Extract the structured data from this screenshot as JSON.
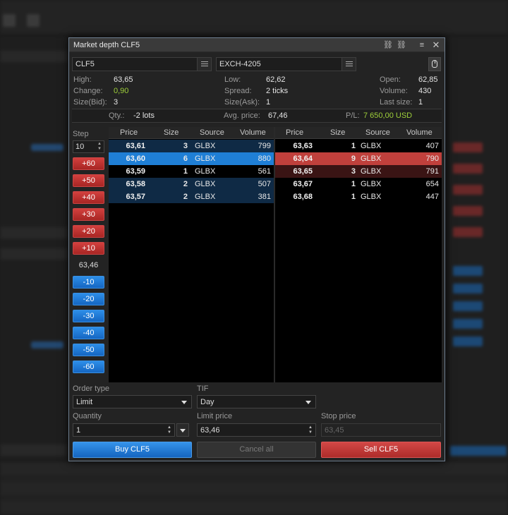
{
  "window": {
    "title": "Market depth CLF5"
  },
  "symbol": {
    "value": "CLF5"
  },
  "exchange": {
    "value": "EXCH-4205"
  },
  "stats": {
    "high_label": "High:",
    "high": "63,65",
    "change_label": "Change:",
    "change": "0,90",
    "size_bid_label": "Size(Bid):",
    "size_bid": "3",
    "low_label": "Low:",
    "low": "62,62",
    "spread_label": "Spread:",
    "spread": "2 ticks",
    "size_ask_label": "Size(Ask):",
    "size_ask": "1",
    "open_label": "Open:",
    "open": "62,85",
    "volume_label": "Volume:",
    "volume": "430",
    "last_size_label": "Last size:",
    "last_size": "1"
  },
  "position": {
    "qty_label": "Qty.:",
    "qty": "-2 lots",
    "avg_label": "Avg. price:",
    "avg": "67,46",
    "pl_label": "P/L:",
    "pl": "7 650,00 USD"
  },
  "step": {
    "label": "Step",
    "value": "10",
    "plus": [
      "+60",
      "+50",
      "+40",
      "+30",
      "+20",
      "+10"
    ],
    "mid": "63,46",
    "minus": [
      "-10",
      "-20",
      "-30",
      "-40",
      "-50",
      "-60"
    ]
  },
  "columns": {
    "price": "Price",
    "size": "Size",
    "source": "Source",
    "volume": "Volume"
  },
  "bids": [
    {
      "price": "63,61",
      "size": "3",
      "source": "GLBX",
      "volume": "799"
    },
    {
      "price": "63,60",
      "size": "6",
      "source": "GLBX",
      "volume": "880"
    },
    {
      "price": "63,59",
      "size": "1",
      "source": "GLBX",
      "volume": "561"
    },
    {
      "price": "63,58",
      "size": "2",
      "source": "GLBX",
      "volume": "507"
    },
    {
      "price": "63,57",
      "size": "2",
      "source": "GLBX",
      "volume": "381"
    }
  ],
  "asks": [
    {
      "price": "63,63",
      "size": "1",
      "source": "GLBX",
      "volume": "407"
    },
    {
      "price": "63,64",
      "size": "9",
      "source": "GLBX",
      "volume": "790"
    },
    {
      "price": "63,65",
      "size": "3",
      "source": "GLBX",
      "volume": "791"
    },
    {
      "price": "63,67",
      "size": "1",
      "source": "GLBX",
      "volume": "654"
    },
    {
      "price": "63,68",
      "size": "1",
      "source": "GLBX",
      "volume": "447"
    }
  ],
  "order": {
    "type_label": "Order type",
    "type": "Limit",
    "tif_label": "TIF",
    "tif": "Day",
    "quantity_label": "Quantity",
    "quantity": "1",
    "limit_label": "Limit price",
    "limit": "63,46",
    "stop_label": "Stop price",
    "stop": "63,45"
  },
  "actions": {
    "buy": "Buy CLF5",
    "cancel": "Cancel all",
    "sell": "Sell CLF5"
  },
  "colors": {
    "bid_row": "#0f2a45",
    "bid_highlight": "#1f7fd6",
    "ask_highlight": "#c0403c",
    "ask_dark": "#3a1414",
    "accent_green": "#9ecf3a"
  }
}
